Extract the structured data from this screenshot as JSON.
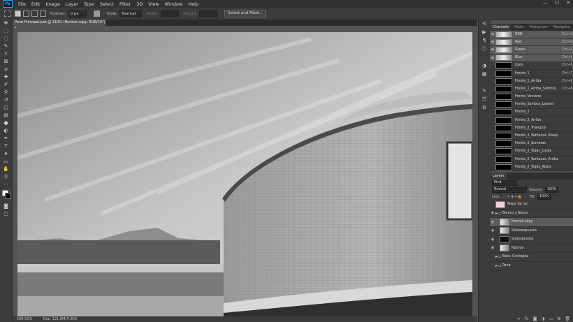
{
  "menu": {
    "logo": "Ps",
    "items": [
      "File",
      "Edit",
      "Image",
      "Layer",
      "Type",
      "Select",
      "Filter",
      "3D",
      "View",
      "Window",
      "Help"
    ]
  },
  "window_controls": {
    "minimize": "—",
    "maximize": "☐",
    "close": "✕"
  },
  "options": {
    "feather_label": "Feather:",
    "feather_value": "0 px",
    "style_label": "Style:",
    "style_value": "Normal",
    "width_label": "Width:",
    "height_label": "Height:",
    "select_mask": "Select and Mask..."
  },
  "document": {
    "tab": "Pano Principal.psb @ 110% (Normal copy, RGB/16*) *",
    "zoom": "109.51%",
    "doc_info": "Doc: 121.6M/4.35G"
  },
  "channels_panel": {
    "tabs": [
      "Channels",
      "Paths",
      "Histogram",
      "Navigator"
    ],
    "rows": [
      {
        "name": "RGB",
        "key": "Ctrl+2",
        "visible": true,
        "sel": true,
        "img": true
      },
      {
        "name": "Red",
        "key": "Ctrl+3",
        "visible": true,
        "sel": true,
        "img": true
      },
      {
        "name": "Green",
        "key": "Ctrl+4",
        "visible": true,
        "sel": true,
        "img": true
      },
      {
        "name": "Blue",
        "key": "Ctrl+5",
        "visible": true,
        "sel": true,
        "img": true
      },
      {
        "name": "Cielo",
        "key": "Ctrl+6",
        "visible": false,
        "sel": false,
        "img": false
      },
      {
        "name": "Frente_1",
        "key": "Ctrl+7",
        "visible": false,
        "sel": false,
        "img": false
      },
      {
        "name": "Frente_1_Arriba",
        "key": "Ctrl+8",
        "visible": false,
        "sel": false,
        "img": false
      },
      {
        "name": "Frente_1_Arriba_Sombra",
        "key": "Ctrl+9",
        "visible": false,
        "sel": false,
        "img": false
      },
      {
        "name": "Frente_Ventana",
        "key": "",
        "visible": false,
        "sel": false,
        "img": false
      },
      {
        "name": "Frente_Sombra_Lateral",
        "key": "",
        "visible": false,
        "sel": false,
        "img": false
      },
      {
        "name": "Frente_2",
        "key": "",
        "visible": false,
        "sel": false,
        "img": false
      },
      {
        "name": "Frente_2_Arriba",
        "key": "",
        "visible": false,
        "sel": false,
        "img": false
      },
      {
        "name": "Frente_2_Triangulo",
        "key": "",
        "visible": false,
        "sel": false,
        "img": false
      },
      {
        "name": "Frente_2_Ventanas_Abajo",
        "key": "",
        "visible": false,
        "sel": false,
        "img": false
      },
      {
        "name": "Frente_2_Sombras",
        "key": "",
        "visible": false,
        "sel": false,
        "img": false
      },
      {
        "name": "Frente_2_Vigas_Luces",
        "key": "",
        "visible": false,
        "sel": false,
        "img": false
      },
      {
        "name": "Frente_2_Ventanas_Arriba",
        "key": "",
        "visible": false,
        "sel": false,
        "img": false
      },
      {
        "name": "Frente_2_Vigas_Abajo",
        "key": "",
        "visible": false,
        "sel": false,
        "img": false
      }
    ]
  },
  "layers_panel": {
    "title": "Layers",
    "kind": "Kind",
    "blend": "Normal",
    "opacity_label": "Opacity:",
    "opacity": "100%",
    "lock_label": "Lock:",
    "fill_label": "Fill:",
    "fill": "100%",
    "rows": [
      {
        "name": "Mapa de luz",
        "type": "layer",
        "thumb": "pink",
        "visible": false,
        "sel": false,
        "indent": 0
      },
      {
        "name": "Blanco y Negro",
        "type": "group",
        "thumb": "",
        "visible": true,
        "sel": false,
        "indent": 0
      },
      {
        "name": "Normal copy",
        "type": "layer",
        "thumb": "grad",
        "visible": true,
        "sel": true,
        "indent": 1
      },
      {
        "name": "Sobreexpuesta",
        "type": "layer",
        "thumb": "grad",
        "visible": true,
        "sel": false,
        "indent": 1
      },
      {
        "name": "Subexpuesta",
        "type": "layer",
        "thumb": "dark",
        "visible": true,
        "sel": false,
        "indent": 1
      },
      {
        "name": "Normal",
        "type": "layer",
        "thumb": "grad",
        "visible": true,
        "sel": false,
        "indent": 1
      },
      {
        "name": "Base_Corregida",
        "type": "group",
        "thumb": "",
        "visible": false,
        "sel": false,
        "indent": 0
      },
      {
        "name": "Pano",
        "type": "group",
        "thumb": "",
        "visible": false,
        "sel": false,
        "indent": 0
      }
    ]
  },
  "icons": {
    "eye": "◉",
    "folder": "▸▭"
  }
}
